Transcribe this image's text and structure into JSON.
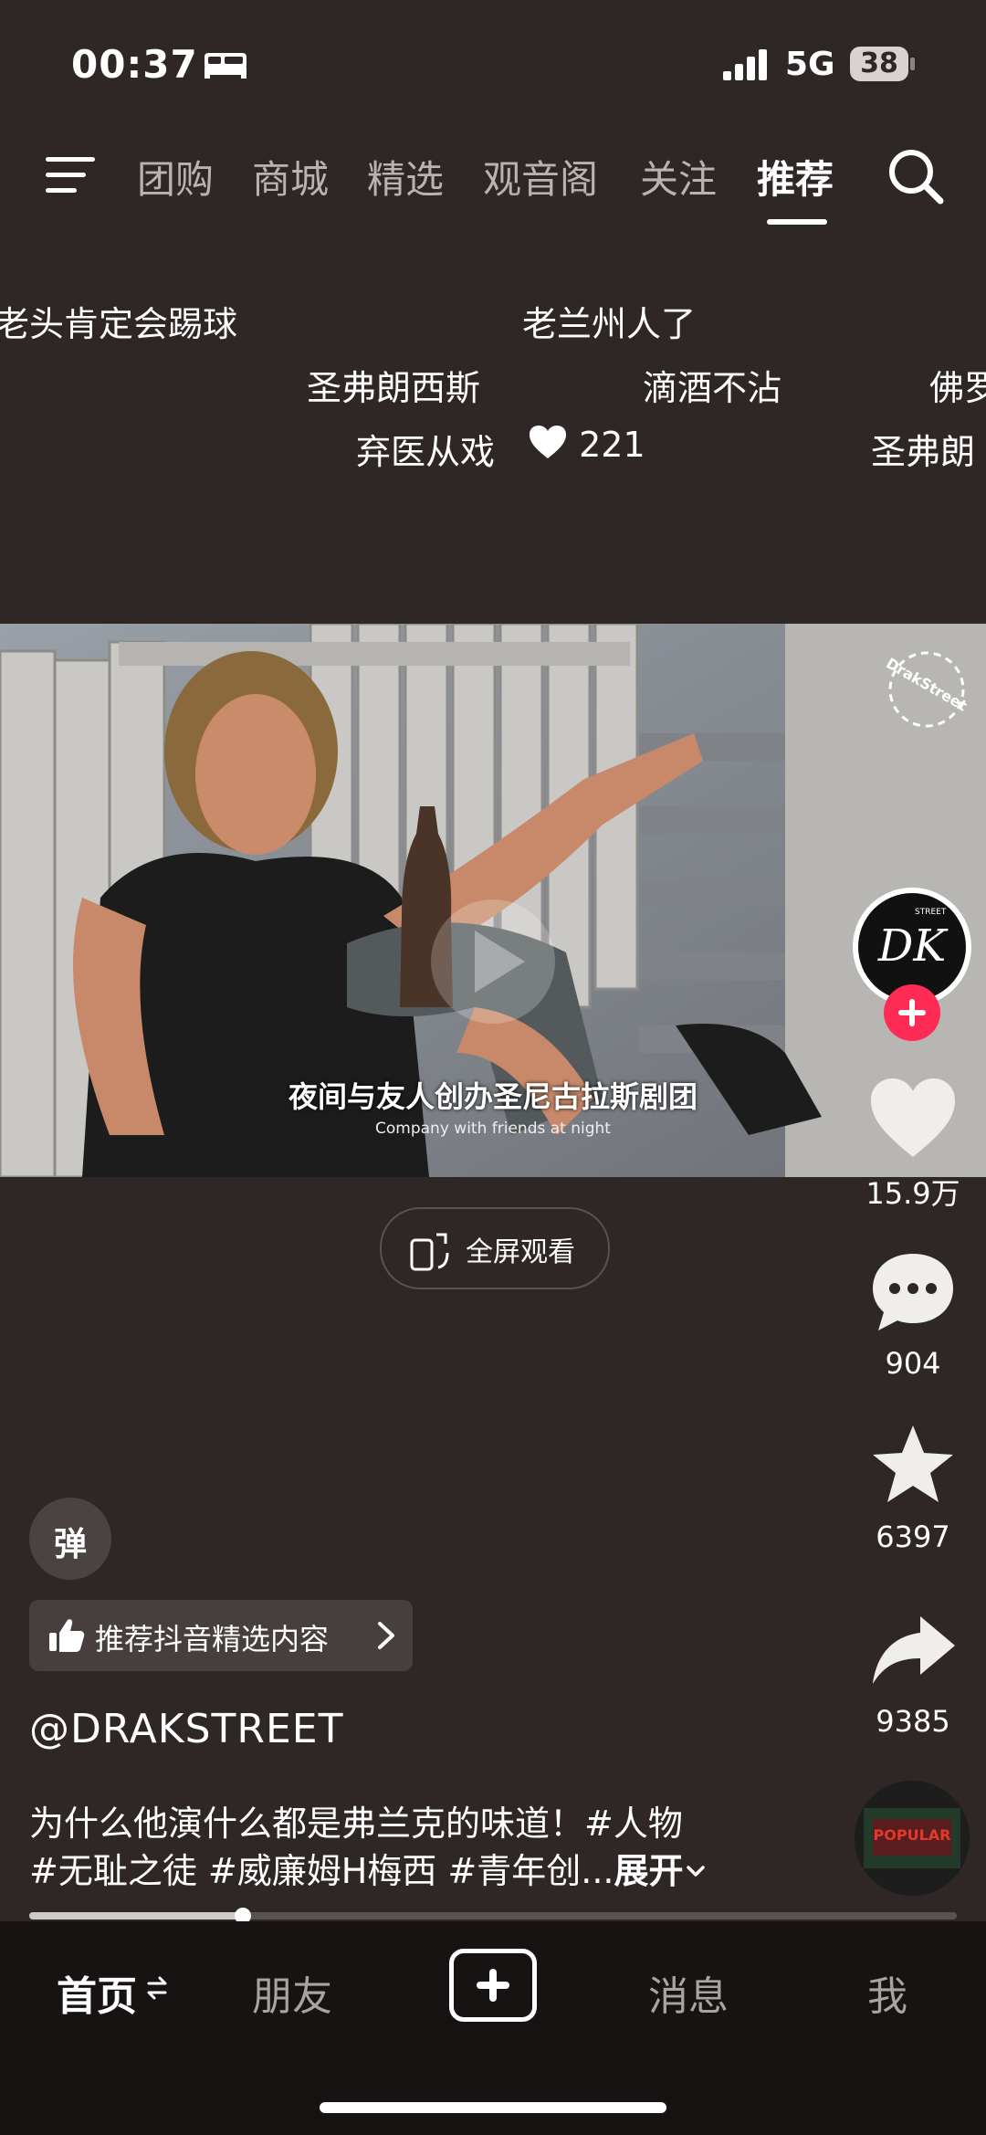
{
  "status_bar": {
    "time": "00:37",
    "network": "5G",
    "battery": "38"
  },
  "top_nav": {
    "tabs": [
      {
        "label": "团购"
      },
      {
        "label": "商城"
      },
      {
        "label": "精选"
      },
      {
        "label": "观音阁"
      },
      {
        "label": "关注"
      },
      {
        "label": "推荐",
        "active": true
      }
    ]
  },
  "danmaku": [
    "老头肯定会踢球",
    "老兰州人了",
    "圣弗朗西斯",
    "滴酒不沾",
    "佛罗",
    "弃医从戏",
    "221",
    "圣弗朗"
  ],
  "video": {
    "subtitle_cn": "夜间与友人创办圣尼古拉斯剧团",
    "subtitle_en": "Company with friends at night",
    "watermark": "DrakStreet",
    "fullscreen_label": "全屏观看"
  },
  "rail": {
    "likes": "15.9万",
    "comments": "904",
    "favorites": "6397",
    "shares": "9385",
    "avatar_text": "DK",
    "avatar_sub": "STREET",
    "disc_text": "POPULAR"
  },
  "post": {
    "danmu_button": "弹",
    "recommend_label": "推荐抖音精选内容",
    "author": "@DRAKSTREET",
    "desc_line1": "为什么他演什么都是弗兰克的味道！#人物",
    "desc_line2": "#无耻之徒 #威廉姆H梅西 #青年创...",
    "expand": "展开",
    "progress": 0.23
  },
  "bottom_nav": {
    "home": "首页",
    "friends": "朋友",
    "messages": "消息",
    "me": "我"
  },
  "colors": {
    "background": "#2e2726",
    "accent": "#fe2c55",
    "nav_bg": "#171313"
  }
}
